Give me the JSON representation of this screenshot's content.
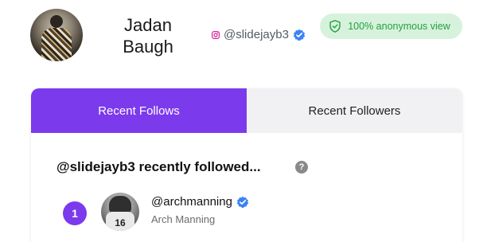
{
  "profile": {
    "name": "Jadan Baugh",
    "handle": "@slidejayb3",
    "verified": true,
    "platform_icon": "instagram-icon"
  },
  "anonymous_badge": {
    "text": "100% anonymous view",
    "icon": "shield-check-icon"
  },
  "tabs": [
    {
      "label": "Recent Follows",
      "active": true
    },
    {
      "label": "Recent Followers",
      "active": false
    }
  ],
  "section": {
    "title": "@slidejayb3 recently followed...",
    "help_icon": "?"
  },
  "follows": [
    {
      "rank": "1",
      "handle": "@archmanning",
      "name": "Arch Manning",
      "verified": true,
      "jersey_number": "16"
    }
  ],
  "colors": {
    "accent": "#7c3aed",
    "verified": "#3b82f6",
    "badge_bg": "#d7f2dc",
    "badge_text": "#23a043",
    "instagram": "#d6249f"
  }
}
